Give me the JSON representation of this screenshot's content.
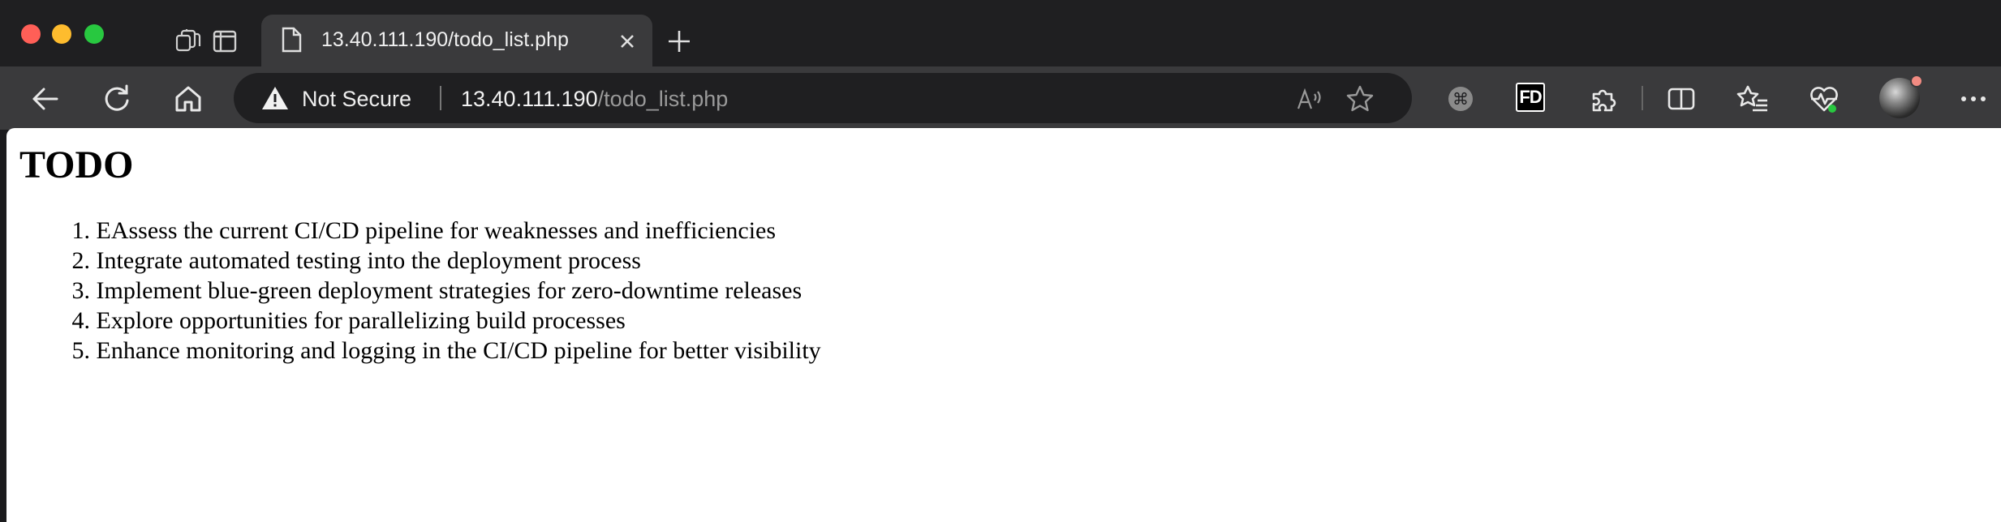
{
  "tab": {
    "title": "13.40.111.190/todo_list.php"
  },
  "address_bar": {
    "security_label": "Not Secure",
    "url_host": "13.40.111.190",
    "url_path": "/todo_list.php"
  },
  "icons": {
    "tab_strip": [
      "tab-actions-icon",
      "vertical-tabs-icon",
      "page-icon",
      "close-tab-icon",
      "new-tab-icon"
    ],
    "toolbar": [
      "back-icon",
      "refresh-icon",
      "home-icon",
      "warning-icon",
      "read-aloud-icon",
      "favorite-star-icon",
      "command-extension-icon",
      "fd-extension-icon",
      "extensions-puzzle-icon",
      "split-screen-icon",
      "favorites-icon",
      "browser-essentials-icon",
      "profile-avatar",
      "more-menu-icon"
    ]
  },
  "colors": {
    "close": "#ff5f57",
    "minimize": "#febc2e",
    "maximize": "#28c840",
    "essentials_dot": "#28c840",
    "profile_badge": "#f28b82"
  },
  "page": {
    "heading": "TODO",
    "items": [
      {
        "num": "1.",
        "text": "EAssess the current CI/CD pipeline for weaknesses and inefficiencies"
      },
      {
        "num": "2.",
        "text": "Integrate automated testing into the deployment process"
      },
      {
        "num": "3.",
        "text": "Implement blue-green deployment strategies for zero-downtime releases"
      },
      {
        "num": "4.",
        "text": "Explore opportunities for parallelizing build processes"
      },
      {
        "num": "5.",
        "text": "Enhance monitoring and logging in the CI/CD pipeline for better visibility"
      }
    ]
  }
}
